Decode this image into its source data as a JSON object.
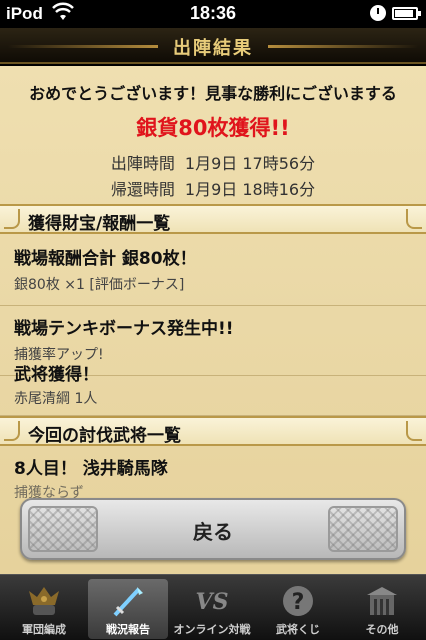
{
  "status_bar": {
    "carrier": "iPod",
    "time": "18:36"
  },
  "header": {
    "title": "出陣結果"
  },
  "result": {
    "message": "おめでとうございます！見事な勝利にございまする",
    "reward": "銀貨80枚獲得!!",
    "departure_label": "出陣時間",
    "departure_value": "1月9日 17時56分",
    "return_label": "帰還時間",
    "return_value": "1月9日 18時16分"
  },
  "sections": {
    "treasure_header": "獲得財宝/報酬一覧",
    "defeated_header": "今回の討伐武将一覧"
  },
  "items": [
    {
      "main": "戦場報酬合計 銀80枚！",
      "sub": "銀80枚 ×1 [評価ボーナス]"
    },
    {
      "main": "戦場テンキボーナス発生中!!",
      "sub": "捕獲率アップ!"
    },
    {
      "main": "武将獲得！",
      "sub": "赤尾清綱 1人"
    },
    {
      "main": "8人目！ 浅井騎馬隊",
      "sub": "捕獲ならず"
    }
  ],
  "back_button": {
    "label": "戻る"
  },
  "tabs": [
    {
      "label": "軍団編成",
      "icon": "helmet-icon"
    },
    {
      "label": "戦況報告",
      "icon": "sword-icon"
    },
    {
      "label": "オンライン対戦",
      "icon": "vs-icon"
    },
    {
      "label": "武将くじ",
      "icon": "question-icon"
    },
    {
      "label": "その他",
      "icon": "castle-gate-icon"
    }
  ],
  "colors": {
    "reward": "#e0141c",
    "parchment": "#ead8a6",
    "title_text": "#e8cc7a"
  }
}
